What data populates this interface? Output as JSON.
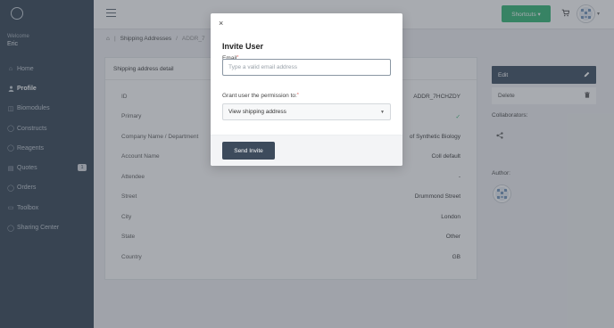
{
  "sidebar": {
    "welcome": "Welcome",
    "username": "Eric",
    "items": [
      {
        "label": "Home",
        "icon": "home-icon",
        "glyph": "⌂"
      },
      {
        "label": "Profile",
        "icon": "user-icon",
        "glyph": "👤"
      },
      {
        "label": "Biomodules",
        "icon": "biomodule-icon",
        "glyph": "◫"
      },
      {
        "label": "Constructs",
        "icon": "construct-icon",
        "glyph": "◯"
      },
      {
        "label": "Reagents",
        "icon": "reagent-icon",
        "glyph": "◯"
      },
      {
        "label": "Quotes",
        "icon": "quote-icon",
        "glyph": "▤",
        "badge": "1"
      },
      {
        "label": "Orders",
        "icon": "order-icon",
        "glyph": "◯"
      },
      {
        "label": "Toolbox",
        "icon": "toolbox-icon",
        "glyph": "▭"
      },
      {
        "label": "Sharing Center",
        "icon": "share-center-icon",
        "glyph": "◯"
      }
    ]
  },
  "topbar": {
    "shortcuts_label": "Shortcuts ▾",
    "accent": "#3dba7c"
  },
  "breadcrumb": {
    "home_glyph": "⌂",
    "section": "Shipping Addresses",
    "current": "ADDR_7"
  },
  "detail": {
    "header": "Shipping address detail",
    "rows": [
      {
        "label": "ID",
        "value": "ADDR_7HCHZDY"
      },
      {
        "label": "Primary",
        "value": "✓"
      },
      {
        "label": "Company Name / Department",
        "value": "of Synthetic Biology"
      },
      {
        "label": "Account Name",
        "value": "Coll default"
      },
      {
        "label": "Attendee",
        "value": "-"
      },
      {
        "label": "Street",
        "value": "Drummond Street"
      },
      {
        "label": "City",
        "value": "London"
      },
      {
        "label": "State",
        "value": "Other"
      },
      {
        "label": "Country",
        "value": "GB"
      }
    ]
  },
  "right_panel": {
    "edit_label": "Edit",
    "delete_label": "Delete",
    "collaborators_label": "Collaborators:",
    "author_label": "Author:"
  },
  "modal": {
    "close_glyph": "×",
    "title": "Invite User",
    "email_label": "Email",
    "email_placeholder": "Type a valid email address",
    "email_value": "",
    "permission_label": "Grant user the permission to:",
    "permission_value": "View shipping address",
    "send_label": "Send Invite"
  }
}
